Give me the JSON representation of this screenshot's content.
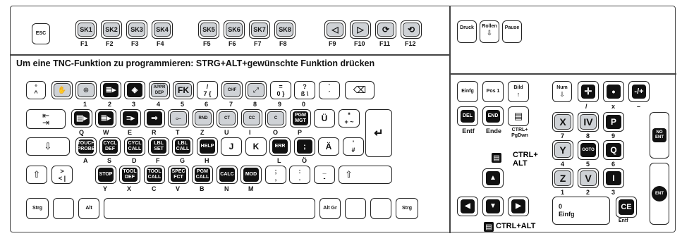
{
  "title": "Um eine TNC-Funktion zu programmieren: STRG+ALT+gewünschte Funktion drücken",
  "function_row": {
    "esc": "ESC",
    "sk_keys": [
      "SK1",
      "SK2",
      "SK3",
      "SK4",
      "SK5",
      "SK6",
      "SK7",
      "SK8"
    ],
    "f_labels": [
      "F1",
      "F2",
      "F3",
      "F4",
      "F5",
      "F6",
      "F7",
      "F8",
      "F9",
      "F10",
      "F11",
      "F12"
    ],
    "druck": "Druck",
    "rollen": "Rollen",
    "pause": "Pause"
  },
  "row1": {
    "labels_below": [
      "1",
      "2",
      "3",
      "4",
      "5",
      "6",
      "7",
      "8",
      "9",
      "0"
    ],
    "appr_dep": "APPR\nDEP",
    "fk": "FK",
    "chf": "CHF",
    "k7": "/\n7 {",
    "k0": "=\n0 }",
    "k_ss": "?\nß \\",
    "k_acc": "`\n´"
  },
  "row2": {
    "letters": [
      "Q",
      "W",
      "E",
      "R",
      "T",
      "Z",
      "U",
      "I",
      "O",
      "P"
    ],
    "rnd": "RND",
    "ct": "CT",
    "cc": "CC",
    "c": "C",
    "pgm_mgt": "PGM\nMGT",
    "ue": "Ü",
    "plus": "*\n+ ~"
  },
  "row3": {
    "letters": [
      "A",
      "S",
      "D",
      "F",
      "G",
      "H",
      "J",
      "K",
      "L",
      "Ö",
      "Ä"
    ],
    "touch_probe": "TOUCH\nPROBE",
    "cycl_def": "CYCL\nDEF",
    "cycl_call": "CYCL\nCALL",
    "lbl_set": "LBL\nSET",
    "lbl_call": "LBL\nCALL",
    "help": "HELP",
    "err": "ERR",
    "hash": "'\n#"
  },
  "row4": {
    "letters": [
      "Y",
      "X",
      "C",
      "V",
      "B",
      "N",
      "M"
    ],
    "angle": ">\n< |",
    "stop": "STOP",
    "tool_def": "TOOL\nDEF",
    "tool_call": "TOOL\nCALL",
    "spec_fct": "SPEC\nFCT",
    "pgm_call": "PGM\nCALL",
    "calc": "CALC",
    "mod": "MOD",
    "semi": ";\n,",
    "colon": ":\n.",
    "dash": "_\n-"
  },
  "row5": {
    "strg": "Strg",
    "alt": "Alt",
    "altgr": "Alt Gr",
    "strg_r": "Strg"
  },
  "nav": {
    "einfg": "Einfg",
    "pos1": "Pos 1",
    "bild": "Bild",
    "del": "DEL",
    "entf": "Entf",
    "end": "END",
    "ende": "Ende",
    "ctrl_pgdwn": "CTRL+\nPgDwn",
    "ctrl_alt_1": "CTRL+\nALT",
    "ctrl_alt_2": "CTRL+ALT"
  },
  "numpad": {
    "num": "Num",
    "keys": [
      {
        "big": "X",
        "small": "7"
      },
      {
        "big": "IV",
        "small": "8"
      },
      {
        "big": "P",
        "small": "9"
      },
      {
        "big": "Y",
        "small": "4"
      },
      {
        "big": "GOTO",
        "small": "5"
      },
      {
        "big": "Q",
        "small": "6"
      },
      {
        "big": "Z",
        "small": "1"
      },
      {
        "big": "V",
        "small": "2"
      },
      {
        "big": "I",
        "small": "3"
      }
    ],
    "slash": "/",
    "x": "x",
    "minus": "–",
    "no_ent": "NO\nENT",
    "ent": "ENT",
    "zero": "0\nEinfg",
    "ce": "CE",
    "ce_sub": "Entf"
  }
}
